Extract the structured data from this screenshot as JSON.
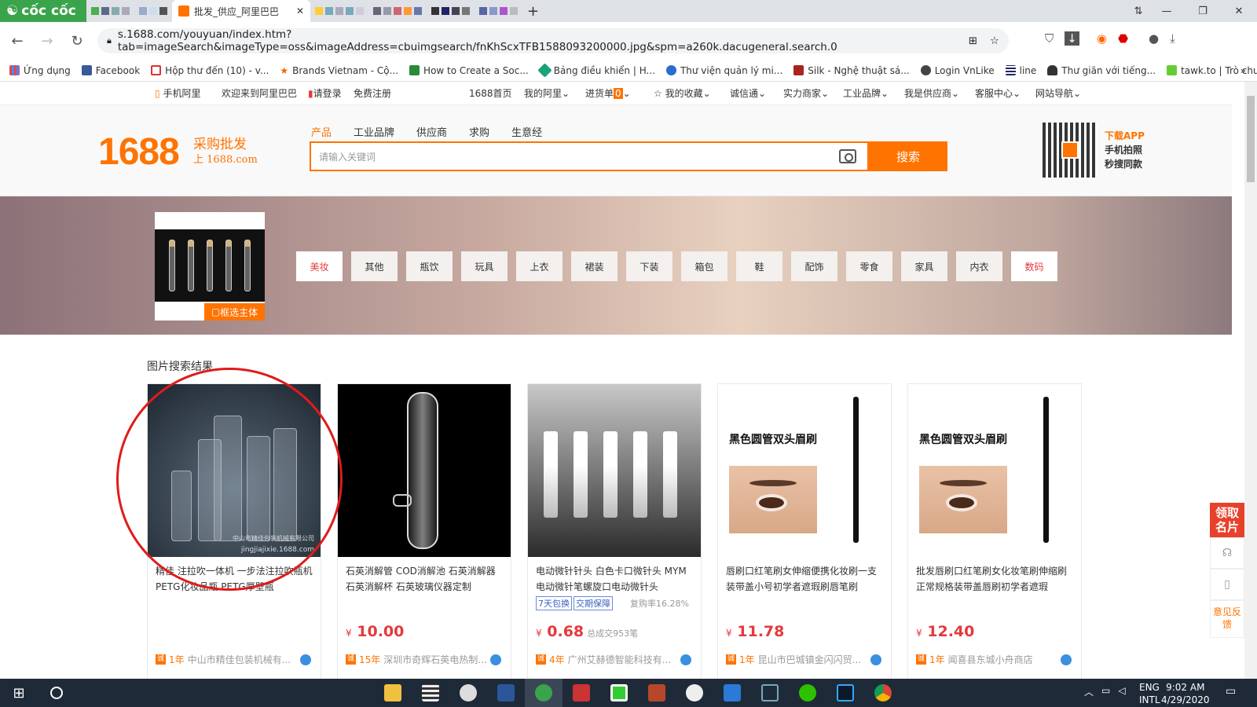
{
  "browser": {
    "brand": "cốc cốc",
    "active_tab_title": "批发_供应_阿里巴巴",
    "url": "s.1688.com/youyuan/index.htm?tab=imageSearch&imageType=oss&imageAddress=cbuimgsearch/fnKhScxTFB1588093200000.jpg&spm=a260k.dacugeneral.search.0",
    "bookmarks": [
      "Ứng dụng",
      "Facebook",
      "Hộp thư đến (10) - v...",
      "Brands Vietnam - Cộ...",
      "How to Create a Soc...",
      "Bảng điều khiển | H...",
      "Thư viện quản lý mi...",
      "Silk - Nghệ thuật sá...",
      "Login VnLike",
      "line",
      "Thư giãn với tiếng...",
      "tawk.to | Trò chuyện"
    ]
  },
  "topnav": {
    "mobile": "手机阿里",
    "welcome": "欢迎来到阿里巴巴",
    "login": "请登录",
    "register": "免费注册",
    "items": [
      "1688首页",
      "我的阿里",
      "进货单",
      "我的收藏",
      "诚信通",
      "实力商家",
      "工业品牌",
      "我是供应商",
      "客服中心",
      "网站导航"
    ],
    "cart_count": "0"
  },
  "header": {
    "logo": "1688",
    "logo_sub1": "采购批发",
    "logo_sub2": "上 1688.com",
    "search_tabs": [
      "产品",
      "工业品牌",
      "供应商",
      "求购",
      "生意经"
    ],
    "search_placeholder": "请输入关键词",
    "search_button": "搜索",
    "app_title": "下载APP",
    "app_line1": "手机拍照",
    "app_line2": "秒搜同款"
  },
  "banner": {
    "frame_button": "框选主体",
    "categories": [
      "美妆",
      "其他",
      "瓶饮",
      "玩具",
      "上衣",
      "裙装",
      "下装",
      "箱包",
      "鞋",
      "配饰",
      "零食",
      "家具",
      "内衣",
      "数码"
    ]
  },
  "results": {
    "title": "图片搜索结果",
    "products": [
      {
        "title": "精佳 注拉吹一体机 一步法注拉吹瓶机 PETG化妆品瓶 PETG厚壁瓶",
        "price": "",
        "sold": "",
        "years": "1年",
        "seller": "中山市精佳包装机械有...",
        "watermark1": "中山市精佳包装机械有限公司",
        "watermark2": "jingjiajixie.1688.com"
      },
      {
        "title": "石英消解管 COD消解池 石英消解器 石英消解杯 石英玻璃仪器定制",
        "price": "10.00",
        "sold": "",
        "years": "15年",
        "seller": "深圳市奇辉石英电热制..."
      },
      {
        "title": "电动微针针头 白色卡口微针头 MYM 电动微针笔螺旋口电动微针头",
        "price": "0.68",
        "sold": "总成交953笔",
        "years": "4年",
        "seller": "广州艾赫德智能科技有...",
        "tag1": "7天包换",
        "tag2": "交期保障",
        "rate": "复购率16.28%"
      },
      {
        "title": "唇刷口红笔刷女伸缩便携化妆刷一支装带盖小号初学者遮瑕刷唇笔刷",
        "price": "11.78",
        "sold": "",
        "years": "1年",
        "seller": "昆山市巴城镇金闪闪贸...",
        "img_label": "黑色圆管双头眉刷"
      },
      {
        "title": "批发唇刷口红笔刷女化妆笔刷伸缩刷正常规格装带盖唇刷初学者遮瑕",
        "price": "12.40",
        "sold": "",
        "years": "1年",
        "seller": "闻喜县东城小舟商店",
        "img_label": "黑色圆管双头眉刷"
      }
    ]
  },
  "sidebar": {
    "card": "领取名片",
    "feedback": "意见反馈"
  },
  "currency": "¥",
  "taskbar": {
    "lang1": "ENG",
    "lang2": "INTL",
    "time": "9:02 AM",
    "date": "4/29/2020"
  }
}
